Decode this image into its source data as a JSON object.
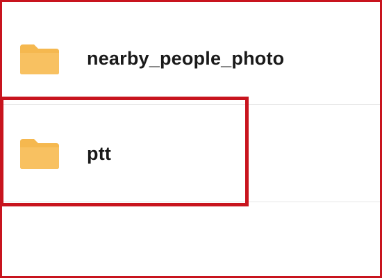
{
  "folders": [
    {
      "name": "nearby_people_photo",
      "icon": "folder-icon"
    },
    {
      "name": "ptt",
      "icon": "folder-icon"
    }
  ],
  "colors": {
    "folder": "#F5B84F",
    "highlight": "#C8141E",
    "divider": "#E6E6E6",
    "text": "#1A1A1A"
  }
}
